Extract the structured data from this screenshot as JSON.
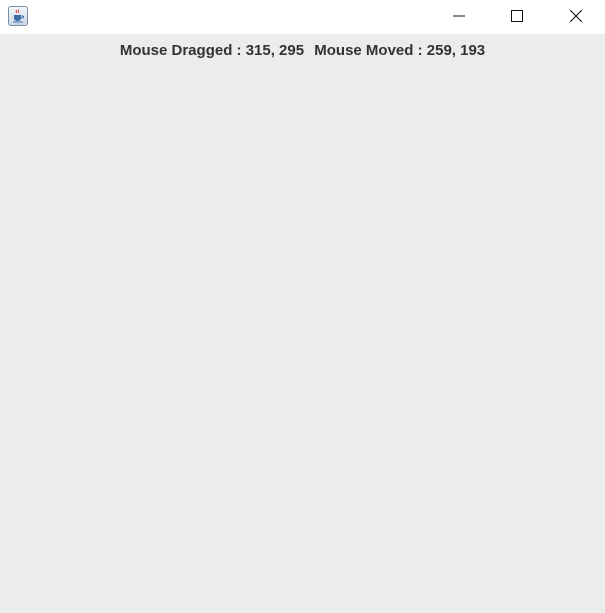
{
  "window": {
    "app_icon": "java-cup-icon",
    "controls": {
      "minimize_icon": "minimize-icon",
      "maximize_icon": "maximize-icon",
      "close_icon": "close-icon"
    }
  },
  "content": {
    "dragged_text": "Mouse Dragged : 315, 295",
    "moved_text": "Mouse Moved : 259, 193"
  },
  "colors": {
    "titlebar_bg": "#ffffff",
    "content_bg": "#ececec",
    "text": "#333333"
  }
}
